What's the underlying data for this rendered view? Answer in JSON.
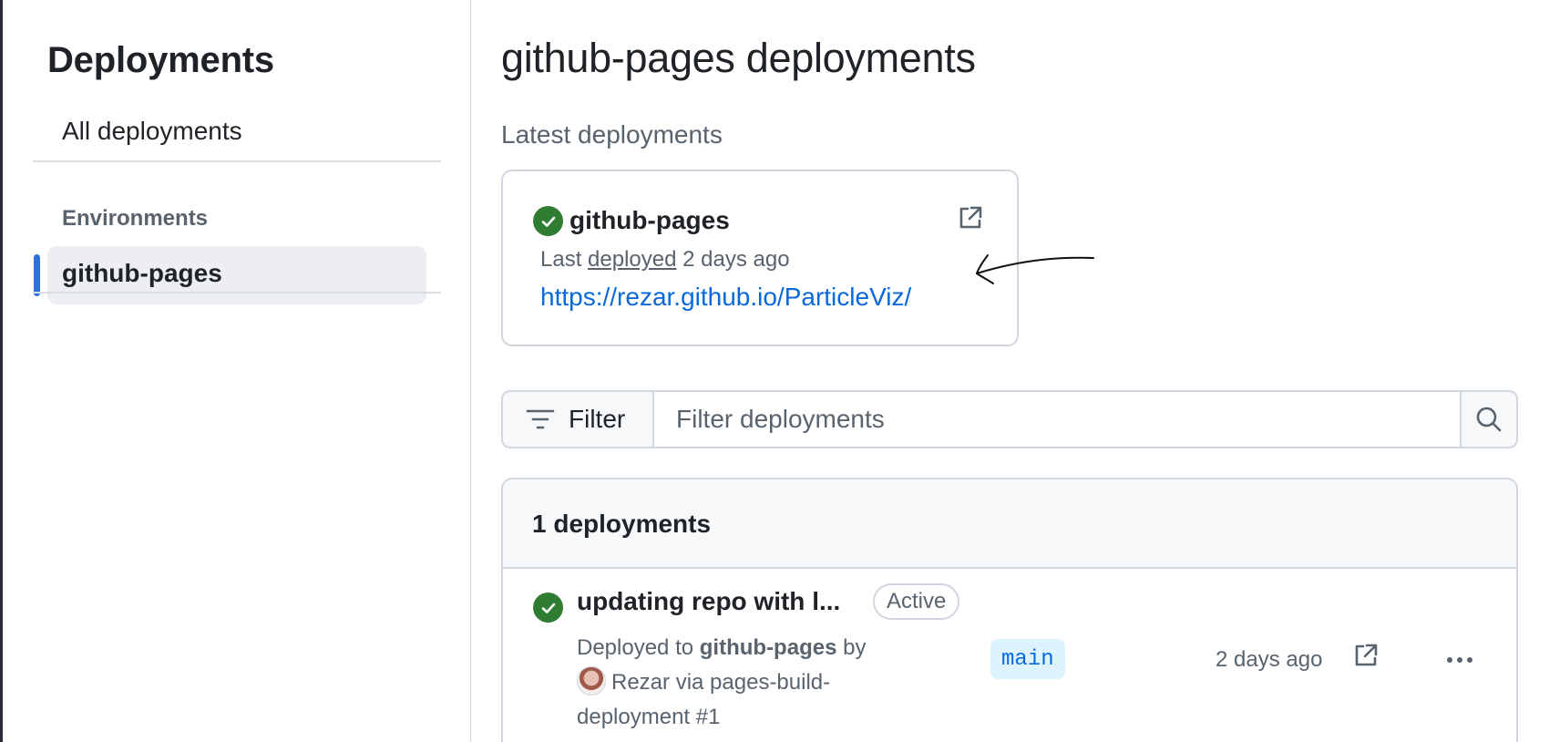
{
  "sidebar": {
    "title": "Deployments",
    "all_link": "All deployments",
    "section_label": "Environments",
    "items": [
      {
        "label": "github-pages",
        "active": true
      }
    ]
  },
  "main": {
    "title": "github-pages deployments",
    "latest_label": "Latest deployments",
    "latest_card": {
      "env_name": "github-pages",
      "meta_prefix": "Last",
      "meta_link": "deployed",
      "meta_time": "2 days ago",
      "url": "https://rezar.github.io/ParticleViz/"
    },
    "filter": {
      "button_label": "Filter",
      "placeholder": "Filter deployments"
    },
    "list": {
      "count_label": "1 deployments",
      "rows": [
        {
          "title": "updating repo with l...",
          "status": "Active",
          "deployed_to_prefix": "Deployed to",
          "environment": "github-pages",
          "by": "by",
          "user": "Rezar",
          "via": "via pages-build-deployment #1",
          "branch": "main",
          "time": "2 days ago"
        }
      ]
    }
  },
  "colors": {
    "accent_blue": "#0969da",
    "success_green": "#2e7d32",
    "active_indicator": "#2f6fdb"
  }
}
